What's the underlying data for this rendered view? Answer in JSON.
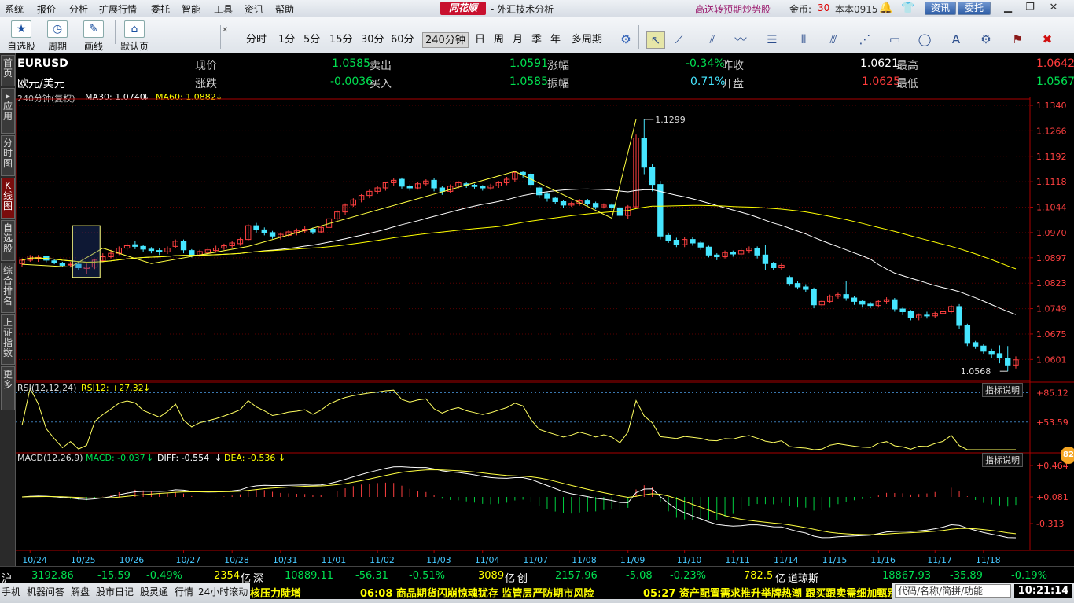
{
  "menu": [
    "系统",
    "报价",
    "分析",
    "扩展行情",
    "委托",
    "智能",
    "工具",
    "资讯",
    "帮助"
  ],
  "brand": "同花顺",
  "app_title": "- 外汇技术分析",
  "promo": "高送转预期炒势股",
  "coins_label": "金币:",
  "coins_value": "30",
  "version": "本本0915",
  "top_buttons": {
    "news": "资讯",
    "trade": "委托"
  },
  "toolbar_left": [
    {
      "label": "自选股",
      "icon": "star-icon"
    },
    {
      "label": "周期",
      "icon": "clock-icon"
    },
    {
      "label": "画线",
      "icon": "pencil-icon"
    },
    {
      "label": "默认页",
      "icon": "home-icon"
    }
  ],
  "periods": [
    "分时",
    "1分",
    "5分",
    "15分",
    "30分",
    "60分",
    "240分钟",
    "日",
    "周",
    "月",
    "季",
    "年",
    "多周期"
  ],
  "active_period": "240分钟",
  "left_tabs": [
    "首页",
    "应用",
    "分时图",
    "K线图",
    "自选股",
    "综合排名",
    "上证指数",
    "更多"
  ],
  "active_left_tab": "K线图",
  "quote": {
    "symbol": "EURUSD",
    "name": "欧元/美元",
    "current_label": "现价",
    "current": "1.0585",
    "change_label": "涨跌",
    "change": "-0.0036",
    "sell_label": "卖出",
    "sell": "1.0591",
    "buy_label": "买入",
    "buy": "1.0585",
    "pct_label": "涨幅",
    "pct": "-0.34%",
    "amp_label": "振幅",
    "amp": "0.71%",
    "prev_label": "昨收",
    "prev": "1.0621",
    "open_label": "开盘",
    "open": "1.0625",
    "high_label": "最高",
    "high": "1.0642",
    "low_label": "最低",
    "low": "1.0567"
  },
  "ma_label": "240分钟(复权)",
  "ma30": "MA30: 1.0740",
  "ma60": "MA60: 1.0882",
  "rsi_label": "RSI(12,12,24)",
  "rsi_value": "RSI12: +27.32",
  "macd_label": "MACD(12,26,9)",
  "macd_value": "MACD: -0.037",
  "diff_value": "DIFF: -0.554",
  "dea_value": "DEA: -0.536",
  "indicator_help": "指标说明",
  "bubble": "82",
  "chart_data": {
    "type": "candlestick",
    "price_ticks": [
      "1.1340",
      "1.1266",
      "1.1192",
      "1.1118",
      "1.1044",
      "1.0970",
      "1.0897",
      "1.0823",
      "1.0749",
      "1.0675",
      "1.0601"
    ],
    "price_range": [
      1.054,
      1.134
    ],
    "rsi_ticks": [
      "+85.12",
      "+53.59"
    ],
    "macd_ticks": [
      "+0.464",
      "+0.081",
      "-0.313"
    ],
    "date_labels": [
      "10/24",
      "10/25",
      "10/26",
      "10/27",
      "10/28",
      "10/31",
      "11/01",
      "11/02",
      "11/03",
      "11/04",
      "11/07",
      "11/08",
      "11/09",
      "11/10",
      "11/11",
      "11/14",
      "11/15",
      "11/16",
      "11/17",
      "11/18"
    ],
    "high_mark": "1.1299",
    "low_mark": "1.0568",
    "candles": [
      [
        1.088,
        1.089,
        1.087,
        1.0895
      ],
      [
        1.089,
        1.0902,
        1.0885,
        1.0905
      ],
      [
        1.0895,
        1.0898,
        1.0885,
        1.0905
      ],
      [
        1.09,
        1.089,
        1.0884,
        1.0903
      ],
      [
        1.0888,
        1.0884,
        1.0878,
        1.0892
      ],
      [
        1.088,
        1.0875,
        1.087,
        1.0885
      ],
      [
        1.0876,
        1.0878,
        1.087,
        1.0885
      ],
      [
        1.0878,
        1.0868,
        1.086,
        1.0882
      ],
      [
        1.0866,
        1.087,
        1.085,
        1.088
      ],
      [
        1.087,
        1.089,
        1.0864,
        1.0894
      ],
      [
        1.0888,
        1.09,
        1.0884,
        1.091
      ],
      [
        1.09,
        1.091,
        1.0895,
        1.092
      ],
      [
        1.091,
        1.0925,
        1.0905,
        1.093
      ],
      [
        1.0925,
        1.0932,
        1.0918,
        1.094
      ],
      [
        1.0935,
        1.093,
        1.0922,
        1.0945
      ],
      [
        1.093,
        1.0922,
        1.0915,
        1.0935
      ],
      [
        1.0922,
        1.0918,
        1.091,
        1.0928
      ],
      [
        1.0918,
        1.0914,
        1.0905,
        1.0925
      ],
      [
        1.0914,
        1.0925,
        1.0908,
        1.093
      ],
      [
        1.093,
        1.0945,
        1.0925,
        1.095
      ],
      [
        1.0945,
        1.092,
        1.091,
        1.095
      ],
      [
        1.0918,
        1.0905,
        1.0898,
        1.0922
      ],
      [
        1.0905,
        1.0915,
        1.09,
        1.092
      ],
      [
        1.0912,
        1.092,
        1.0905,
        1.0928
      ],
      [
        1.0918,
        1.0925,
        1.0912,
        1.0932
      ],
      [
        1.0925,
        1.0932,
        1.092,
        1.0938
      ],
      [
        1.0932,
        1.094,
        1.0925,
        1.0945
      ],
      [
        1.0938,
        1.095,
        1.0932,
        1.0955
      ],
      [
        1.095,
        1.099,
        1.0945,
        1.0995
      ],
      [
        1.099,
        1.0978,
        1.097,
        1.0998
      ],
      [
        1.0978,
        1.097,
        1.0962,
        1.0985
      ],
      [
        1.097,
        1.096,
        1.0952,
        1.0975
      ],
      [
        1.0958,
        1.0965,
        1.095,
        1.097
      ],
      [
        1.0962,
        1.0972,
        1.0958,
        1.0978
      ],
      [
        1.097,
        1.0975,
        1.0962,
        1.0982
      ],
      [
        1.0975,
        1.098,
        1.0968,
        1.0988
      ],
      [
        1.098,
        1.0972,
        1.0965,
        1.0985
      ],
      [
        1.0972,
        1.0985,
        1.0968,
        1.099
      ],
      [
        1.0985,
        1.101,
        1.098,
        1.1015
      ],
      [
        1.101,
        1.103,
        1.1005,
        1.1035
      ],
      [
        1.103,
        1.105,
        1.1022,
        1.1055
      ],
      [
        1.105,
        1.1065,
        1.1045,
        1.107
      ],
      [
        1.1065,
        1.1078,
        1.1058,
        1.1082
      ],
      [
        1.1078,
        1.109,
        1.107,
        1.1095
      ],
      [
        1.109,
        1.11,
        1.1082,
        1.1105
      ],
      [
        1.11,
        1.1115,
        1.1092,
        1.1118
      ],
      [
        1.1115,
        1.1122,
        1.1105,
        1.1128
      ],
      [
        1.1125,
        1.1105,
        1.1098,
        1.113
      ],
      [
        1.1105,
        1.11,
        1.1092,
        1.111
      ],
      [
        1.11,
        1.1112,
        1.1095,
        1.1118
      ],
      [
        1.1112,
        1.112,
        1.1105,
        1.1125
      ],
      [
        1.1122,
        1.11,
        1.109,
        1.1128
      ],
      [
        1.11,
        1.109,
        1.108,
        1.1105
      ],
      [
        1.109,
        1.1105,
        1.1085,
        1.111
      ],
      [
        1.1105,
        1.1115,
        1.1098,
        1.112
      ],
      [
        1.1112,
        1.1108,
        1.11,
        1.1118
      ],
      [
        1.1108,
        1.1104,
        1.1098,
        1.1112
      ],
      [
        1.1104,
        1.11,
        1.1092,
        1.1108
      ],
      [
        1.11,
        1.1106,
        1.1094,
        1.1112
      ],
      [
        1.1106,
        1.1115,
        1.11,
        1.112
      ],
      [
        1.1115,
        1.1125,
        1.1108,
        1.1132
      ],
      [
        1.1125,
        1.1145,
        1.1118,
        1.115
      ],
      [
        1.1145,
        1.114,
        1.113,
        1.115
      ],
      [
        1.114,
        1.111,
        1.11,
        1.1145
      ],
      [
        1.11,
        1.108,
        1.107,
        1.1105
      ],
      [
        1.1082,
        1.107,
        1.106,
        1.1088
      ],
      [
        1.107,
        1.106,
        1.1052,
        1.1075
      ],
      [
        1.106,
        1.105,
        1.1042,
        1.1065
      ],
      [
        1.105,
        1.1055,
        1.1045,
        1.106
      ],
      [
        1.1055,
        1.1062,
        1.1048,
        1.1068
      ],
      [
        1.1062,
        1.1055,
        1.1048,
        1.1068
      ],
      [
        1.1055,
        1.1045,
        1.1038,
        1.106
      ],
      [
        1.1045,
        1.105,
        1.104,
        1.1055
      ],
      [
        1.105,
        1.1042,
        1.1035,
        1.1055
      ],
      [
        1.1042,
        1.102,
        1.1012,
        1.1048
      ],
      [
        1.102,
        1.1045,
        1.101,
        1.105
      ],
      [
        1.1045,
        1.1245,
        1.104,
        1.1255
      ],
      [
        1.1245,
        1.116,
        1.114,
        1.1299
      ],
      [
        1.116,
        1.111,
        1.109,
        1.117
      ],
      [
        1.111,
        1.096,
        1.095,
        1.112
      ],
      [
        1.0962,
        1.0948,
        1.094,
        1.097
      ],
      [
        1.0948,
        1.0935,
        1.0928,
        1.0955
      ],
      [
        1.0935,
        1.095,
        1.0928,
        1.0958
      ],
      [
        1.095,
        1.094,
        1.0932,
        1.0956
      ],
      [
        1.094,
        1.0928,
        1.092,
        1.0945
      ],
      [
        1.0928,
        1.0905,
        1.0898,
        1.0932
      ],
      [
        1.0905,
        1.09,
        1.089,
        1.091
      ],
      [
        1.09,
        1.0912,
        1.0895,
        1.0918
      ],
      [
        1.0912,
        1.0908,
        1.09,
        1.0918
      ],
      [
        1.0908,
        1.0918,
        1.0902,
        1.0925
      ],
      [
        1.0918,
        1.0925,
        1.091,
        1.093
      ],
      [
        1.0925,
        1.0905,
        1.0895,
        1.093
      ],
      [
        1.0905,
        1.088,
        1.086,
        1.0935
      ],
      [
        1.088,
        1.0868,
        1.086,
        1.0885
      ],
      [
        1.0868,
        1.0875,
        1.086,
        1.0882
      ],
      [
        1.084,
        1.0822,
        1.0815,
        1.0845
      ],
      [
        1.0822,
        1.0812,
        1.0805,
        1.0828
      ],
      [
        1.0812,
        1.0805,
        1.0798,
        1.082
      ],
      [
        1.0805,
        1.076,
        1.075,
        1.081
      ],
      [
        1.076,
        1.077,
        1.0755,
        1.0775
      ],
      [
        1.077,
        1.0785,
        1.0765,
        1.079
      ],
      [
        1.0785,
        1.079,
        1.0778,
        1.0795
      ],
      [
        1.079,
        1.078,
        1.0772,
        1.083
      ],
      [
        1.078,
        1.077,
        1.076,
        1.0785
      ],
      [
        1.077,
        1.0762,
        1.0752,
        1.0775
      ],
      [
        1.0762,
        1.0758,
        1.075,
        1.0768
      ],
      [
        1.0758,
        1.077,
        1.0752,
        1.0775
      ],
      [
        1.077,
        1.0775,
        1.0762,
        1.0782
      ],
      [
        1.0775,
        1.0748,
        1.074,
        1.078
      ],
      [
        1.0748,
        1.074,
        1.073,
        1.0752
      ],
      [
        1.074,
        1.0722,
        1.0715,
        1.0745
      ],
      [
        1.0722,
        1.073,
        1.0715,
        1.0735
      ],
      [
        1.073,
        1.0728,
        1.072,
        1.074
      ],
      [
        1.0728,
        1.0735,
        1.0722,
        1.074
      ],
      [
        1.0735,
        1.074,
        1.0728,
        1.0748
      ],
      [
        1.074,
        1.0755,
        1.0735,
        1.076
      ],
      [
        1.0755,
        1.07,
        1.069,
        1.0762
      ],
      [
        1.07,
        1.065,
        1.064,
        1.0705
      ],
      [
        1.065,
        1.064,
        1.0632,
        1.0655
      ],
      [
        1.064,
        1.0625,
        1.0618,
        1.0645
      ],
      [
        1.0625,
        1.0618,
        1.0605,
        1.0632
      ],
      [
        1.0618,
        1.0605,
        1.059,
        1.0642
      ],
      [
        1.0605,
        1.0585,
        1.0567,
        1.064
      ],
      [
        1.0585,
        1.06,
        1.0575,
        1.061
      ]
    ]
  },
  "indices": [
    {
      "name": "沪",
      "value": "3192.86",
      "change": "-15.59",
      "pct": "-0.49%",
      "amount": "2354",
      "unit": "亿"
    },
    {
      "name": "深",
      "value": "10889.11",
      "change": "-56.31",
      "pct": "-0.51%",
      "amount": "3089",
      "unit": "亿"
    },
    {
      "name": "创",
      "value": "2157.96",
      "change": "-5.08",
      "pct": "-0.23%",
      "amount": "782.5",
      "unit": "亿"
    },
    {
      "name": "道琼斯",
      "value": "18867.93",
      "change": "-35.89",
      "pct": "-0.19%"
    }
  ],
  "status_items": [
    "手机",
    "机器问答",
    "解盘",
    "股市日记",
    "股灵通",
    "行情",
    "24小时滚动"
  ],
  "ticker": [
    "核压力陡增",
    "06:08 商品期货闪崩惊魂犹存 监管层严防期市风险",
    "05:27 资产配置需求推升举牌热潮 跟买跟卖需细加甄别"
  ],
  "code_box": "代码/名称/简拼/功能",
  "clock": "10:21:14",
  "colors": {
    "up": "#ff4040",
    "down": "#46e6ff",
    "ma30": "#ffffff",
    "ma60": "#ffff00",
    "grid": "#5a0000",
    "axis": "#aa0000"
  }
}
